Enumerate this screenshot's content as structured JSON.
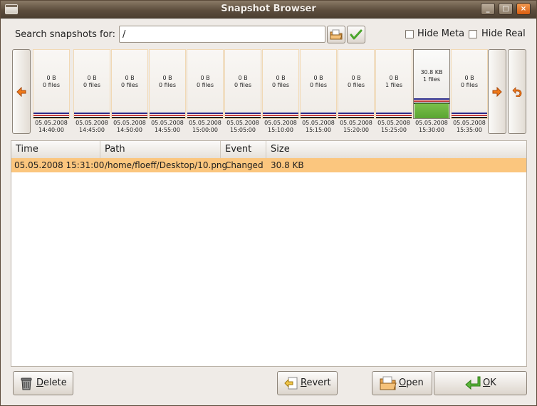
{
  "window": {
    "title": "Snapshot Browser",
    "btn_min": "_",
    "btn_max": "□",
    "btn_close": "×"
  },
  "search": {
    "label": "Search snapshots for:",
    "value": "/"
  },
  "options": {
    "hide_meta": "Hide Meta",
    "hide_real": "Hide Real"
  },
  "snapshots": [
    {
      "size": "0 B",
      "files": "0 files",
      "date": "05.05.2008",
      "time": "14:40:00"
    },
    {
      "size": "0 B",
      "files": "0 files",
      "date": "05.05.2008",
      "time": "14:45:00"
    },
    {
      "size": "0 B",
      "files": "0 files",
      "date": "05.05.2008",
      "time": "14:50:00"
    },
    {
      "size": "0 B",
      "files": "0 files",
      "date": "05.05.2008",
      "time": "14:55:00"
    },
    {
      "size": "0 B",
      "files": "0 files",
      "date": "05.05.2008",
      "time": "15:00:00"
    },
    {
      "size": "0 B",
      "files": "0 files",
      "date": "05.05.2008",
      "time": "15:05:00"
    },
    {
      "size": "0 B",
      "files": "0 files",
      "date": "05.05.2008",
      "time": "15:10:00"
    },
    {
      "size": "0 B",
      "files": "0 files",
      "date": "05.05.2008",
      "time": "15:15:00"
    },
    {
      "size": "0 B",
      "files": "0 files",
      "date": "05.05.2008",
      "time": "15:20:00"
    },
    {
      "size": "0 B",
      "files": "1 files",
      "date": "05.05.2008",
      "time": "15:25:00"
    },
    {
      "size": "30.8 KB",
      "files": "1 files",
      "date": "05.05.2008",
      "time": "15:30:00"
    },
    {
      "size": "0 B",
      "files": "0 files",
      "date": "05.05.2008",
      "time": "15:35:00"
    }
  ],
  "table": {
    "headers": [
      "Time",
      "Path",
      "Event",
      "Size"
    ],
    "rows": [
      [
        "05.05.2008 15:31:00",
        "/home/floeff/Desktop/10.png",
        "Changed",
        "30.8 KB"
      ]
    ]
  },
  "buttons": {
    "delete_first": "D",
    "delete_rest": "elete",
    "revert_first": "R",
    "revert_rest": "evert",
    "open_first": "O",
    "open_rest": "pen",
    "ok_first": "O",
    "ok_rest": "K"
  },
  "colors": {
    "selected_row": "#fbc67e",
    "accent": "#f07a1a",
    "ok_green": "#4aa52a"
  }
}
